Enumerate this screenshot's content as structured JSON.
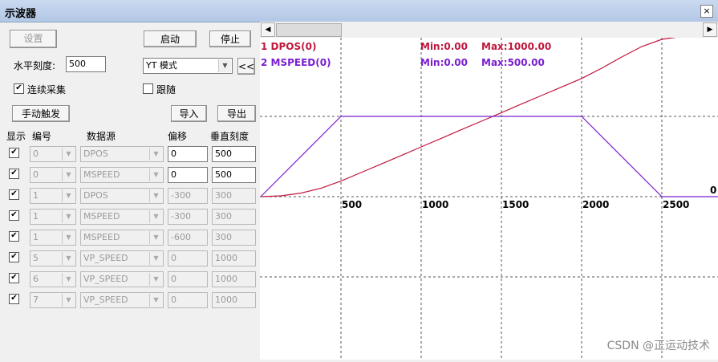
{
  "window": {
    "title": "示波器",
    "close": "×"
  },
  "toolbar": {
    "settings": "设置",
    "start": "启动",
    "stop": "停止",
    "hscale_label": "水平刻度:",
    "hscale_value": "500",
    "mode_value": "YT 模式",
    "collapse": "<<",
    "continuous": "连续采集",
    "follow": "跟随",
    "manual_trigger": "手动触发",
    "import": "导入",
    "export": "导出"
  },
  "columns": {
    "show": "显示",
    "num": "编号",
    "source": "数据源",
    "offset": "偏移",
    "vscale": "垂直刻度"
  },
  "rows": [
    {
      "show": true,
      "num": "0",
      "source": "DPOS",
      "offset": "0",
      "vscale": "500",
      "enabled": true
    },
    {
      "show": true,
      "num": "0",
      "source": "MSPEED",
      "offset": "0",
      "vscale": "500",
      "enabled": true
    },
    {
      "show": true,
      "num": "1",
      "source": "DPOS",
      "offset": "-300",
      "vscale": "300",
      "enabled": false
    },
    {
      "show": true,
      "num": "1",
      "source": "MSPEED",
      "offset": "-300",
      "vscale": "300",
      "enabled": false
    },
    {
      "show": true,
      "num": "1",
      "source": "MSPEED",
      "offset": "-600",
      "vscale": "300",
      "enabled": false
    },
    {
      "show": true,
      "num": "5",
      "source": "VP_SPEED",
      "offset": "0",
      "vscale": "1000",
      "enabled": false
    },
    {
      "show": true,
      "num": "6",
      "source": "VP_SPEED",
      "offset": "0",
      "vscale": "1000",
      "enabled": false
    },
    {
      "show": true,
      "num": "7",
      "source": "VP_SPEED",
      "offset": "0",
      "vscale": "1000",
      "enabled": false
    }
  ],
  "chart_data": {
    "type": "line",
    "xlabel": "",
    "ylabel": "",
    "x_ticks": [
      "500",
      "1000",
      "1500",
      "2000",
      "2500"
    ],
    "y_zero_label": "0",
    "series": [
      {
        "name": "1 DPOS(0)",
        "min_label": "Min:0.00",
        "max_label": "Max:1000.00",
        "color": "#c0163c",
        "points": [
          [
            0,
            0
          ],
          [
            125,
            5
          ],
          [
            250,
            22
          ],
          [
            375,
            52
          ],
          [
            500,
            97
          ],
          [
            625,
            150
          ],
          [
            750,
            203
          ],
          [
            875,
            256
          ],
          [
            1000,
            310
          ],
          [
            1125,
            363
          ],
          [
            1250,
            417
          ],
          [
            1375,
            470
          ],
          [
            1500,
            523
          ],
          [
            1625,
            577
          ],
          [
            1750,
            630
          ],
          [
            1875,
            683
          ],
          [
            2000,
            736
          ],
          [
            2125,
            800
          ],
          [
            2250,
            870
          ],
          [
            2375,
            935
          ],
          [
            2500,
            980
          ],
          [
            2625,
            998
          ],
          [
            2750,
            1000
          ]
        ]
      },
      {
        "name": "2 MSPEED(0)",
        "min_label": "Min:0.00",
        "max_label": "Max:500.00",
        "color": "#7a1fd1",
        "points": [
          [
            0,
            0
          ],
          [
            500,
            500
          ],
          [
            2000,
            500
          ],
          [
            2500,
            0
          ],
          [
            2850,
            0
          ]
        ]
      }
    ],
    "xlim": [
      0,
      2850
    ],
    "ylim": [
      -500,
      1000
    ],
    "grid": true
  },
  "watermark": "CSDN @正运动技术"
}
